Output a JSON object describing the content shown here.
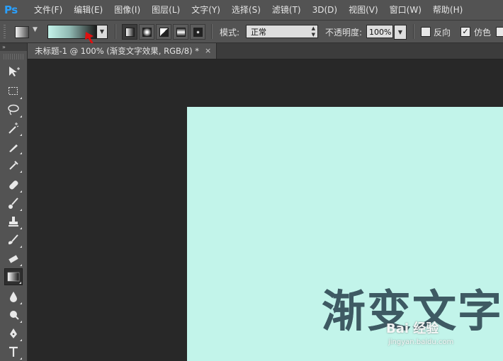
{
  "app": {
    "logo": "Ps"
  },
  "menu": [
    "文件(F)",
    "编辑(E)",
    "图像(I)",
    "图层(L)",
    "文字(Y)",
    "选择(S)",
    "滤镜(T)",
    "3D(D)",
    "视图(V)",
    "窗口(W)",
    "帮助(H)"
  ],
  "options": {
    "gradient_colors": [
      "#c4f3ea",
      "#8fb8b2",
      "#1a1a1a"
    ],
    "gradient_types": [
      "linear-gradient-icon",
      "radial-gradient-icon",
      "angle-gradient-icon",
      "reflected-gradient-icon",
      "diamond-gradient-icon"
    ],
    "active_gradient_type": "linear",
    "mode_label": "模式:",
    "mode_value": "正常",
    "opacity_label": "不透明度:",
    "opacity_value": "100%",
    "reverse_label": "反向",
    "reverse_checked": false,
    "dither_label": "仿色",
    "dither_checked": true
  },
  "document": {
    "tab_title": "未标题-1 @ 100% (渐变文字效果, RGB/8) *",
    "close": "×",
    "canvas_color": "#c2f4ea",
    "canvas_text": "渐变文字"
  },
  "watermark": {
    "brand": "Bai 经验",
    "url": "jingyan.baidu.com"
  },
  "toolbox": {
    "header": "»",
    "active_tool": "gradient-tool"
  },
  "annotation_color": "#e01010"
}
